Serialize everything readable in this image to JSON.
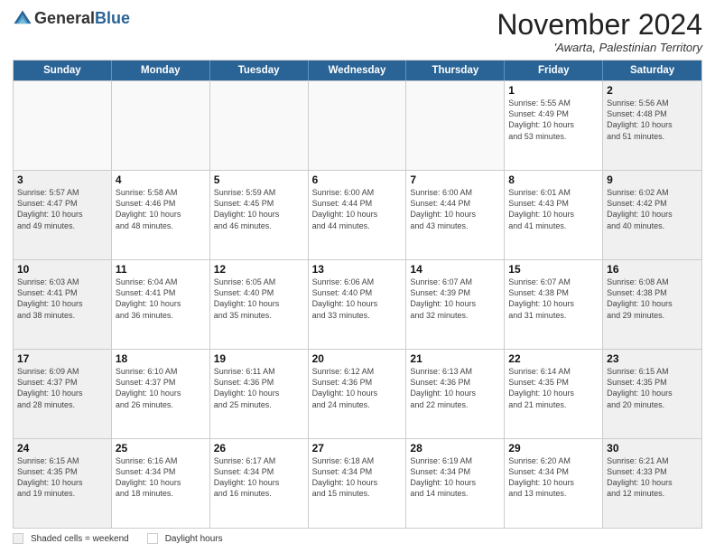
{
  "logo": {
    "general": "General",
    "blue": "Blue"
  },
  "header": {
    "month": "November 2024",
    "location": "'Awarta, Palestinian Territory"
  },
  "weekdays": [
    "Sunday",
    "Monday",
    "Tuesday",
    "Wednesday",
    "Thursday",
    "Friday",
    "Saturday"
  ],
  "weeks": [
    [
      {
        "day": "",
        "detail": "",
        "empty": true
      },
      {
        "day": "",
        "detail": "",
        "empty": true
      },
      {
        "day": "",
        "detail": "",
        "empty": true
      },
      {
        "day": "",
        "detail": "",
        "empty": true
      },
      {
        "day": "",
        "detail": "",
        "empty": true
      },
      {
        "day": "1",
        "detail": "Sunrise: 5:55 AM\nSunset: 4:49 PM\nDaylight: 10 hours\nand 53 minutes."
      },
      {
        "day": "2",
        "detail": "Sunrise: 5:56 AM\nSunset: 4:48 PM\nDaylight: 10 hours\nand 51 minutes."
      }
    ],
    [
      {
        "day": "3",
        "detail": "Sunrise: 5:57 AM\nSunset: 4:47 PM\nDaylight: 10 hours\nand 49 minutes."
      },
      {
        "day": "4",
        "detail": "Sunrise: 5:58 AM\nSunset: 4:46 PM\nDaylight: 10 hours\nand 48 minutes."
      },
      {
        "day": "5",
        "detail": "Sunrise: 5:59 AM\nSunset: 4:45 PM\nDaylight: 10 hours\nand 46 minutes."
      },
      {
        "day": "6",
        "detail": "Sunrise: 6:00 AM\nSunset: 4:44 PM\nDaylight: 10 hours\nand 44 minutes."
      },
      {
        "day": "7",
        "detail": "Sunrise: 6:00 AM\nSunset: 4:44 PM\nDaylight: 10 hours\nand 43 minutes."
      },
      {
        "day": "8",
        "detail": "Sunrise: 6:01 AM\nSunset: 4:43 PM\nDaylight: 10 hours\nand 41 minutes."
      },
      {
        "day": "9",
        "detail": "Sunrise: 6:02 AM\nSunset: 4:42 PM\nDaylight: 10 hours\nand 40 minutes."
      }
    ],
    [
      {
        "day": "10",
        "detail": "Sunrise: 6:03 AM\nSunset: 4:41 PM\nDaylight: 10 hours\nand 38 minutes."
      },
      {
        "day": "11",
        "detail": "Sunrise: 6:04 AM\nSunset: 4:41 PM\nDaylight: 10 hours\nand 36 minutes."
      },
      {
        "day": "12",
        "detail": "Sunrise: 6:05 AM\nSunset: 4:40 PM\nDaylight: 10 hours\nand 35 minutes."
      },
      {
        "day": "13",
        "detail": "Sunrise: 6:06 AM\nSunset: 4:40 PM\nDaylight: 10 hours\nand 33 minutes."
      },
      {
        "day": "14",
        "detail": "Sunrise: 6:07 AM\nSunset: 4:39 PM\nDaylight: 10 hours\nand 32 minutes."
      },
      {
        "day": "15",
        "detail": "Sunrise: 6:07 AM\nSunset: 4:38 PM\nDaylight: 10 hours\nand 31 minutes."
      },
      {
        "day": "16",
        "detail": "Sunrise: 6:08 AM\nSunset: 4:38 PM\nDaylight: 10 hours\nand 29 minutes."
      }
    ],
    [
      {
        "day": "17",
        "detail": "Sunrise: 6:09 AM\nSunset: 4:37 PM\nDaylight: 10 hours\nand 28 minutes."
      },
      {
        "day": "18",
        "detail": "Sunrise: 6:10 AM\nSunset: 4:37 PM\nDaylight: 10 hours\nand 26 minutes."
      },
      {
        "day": "19",
        "detail": "Sunrise: 6:11 AM\nSunset: 4:36 PM\nDaylight: 10 hours\nand 25 minutes."
      },
      {
        "day": "20",
        "detail": "Sunrise: 6:12 AM\nSunset: 4:36 PM\nDaylight: 10 hours\nand 24 minutes."
      },
      {
        "day": "21",
        "detail": "Sunrise: 6:13 AM\nSunset: 4:36 PM\nDaylight: 10 hours\nand 22 minutes."
      },
      {
        "day": "22",
        "detail": "Sunrise: 6:14 AM\nSunset: 4:35 PM\nDaylight: 10 hours\nand 21 minutes."
      },
      {
        "day": "23",
        "detail": "Sunrise: 6:15 AM\nSunset: 4:35 PM\nDaylight: 10 hours\nand 20 minutes."
      }
    ],
    [
      {
        "day": "24",
        "detail": "Sunrise: 6:15 AM\nSunset: 4:35 PM\nDaylight: 10 hours\nand 19 minutes."
      },
      {
        "day": "25",
        "detail": "Sunrise: 6:16 AM\nSunset: 4:34 PM\nDaylight: 10 hours\nand 18 minutes."
      },
      {
        "day": "26",
        "detail": "Sunrise: 6:17 AM\nSunset: 4:34 PM\nDaylight: 10 hours\nand 16 minutes."
      },
      {
        "day": "27",
        "detail": "Sunrise: 6:18 AM\nSunset: 4:34 PM\nDaylight: 10 hours\nand 15 minutes."
      },
      {
        "day": "28",
        "detail": "Sunrise: 6:19 AM\nSunset: 4:34 PM\nDaylight: 10 hours\nand 14 minutes."
      },
      {
        "day": "29",
        "detail": "Sunrise: 6:20 AM\nSunset: 4:34 PM\nDaylight: 10 hours\nand 13 minutes."
      },
      {
        "day": "30",
        "detail": "Sunrise: 6:21 AM\nSunset: 4:33 PM\nDaylight: 10 hours\nand 12 minutes."
      }
    ]
  ],
  "legend": {
    "shaded_label": "Shaded cells = weekend",
    "daylight_label": "Daylight hours"
  }
}
